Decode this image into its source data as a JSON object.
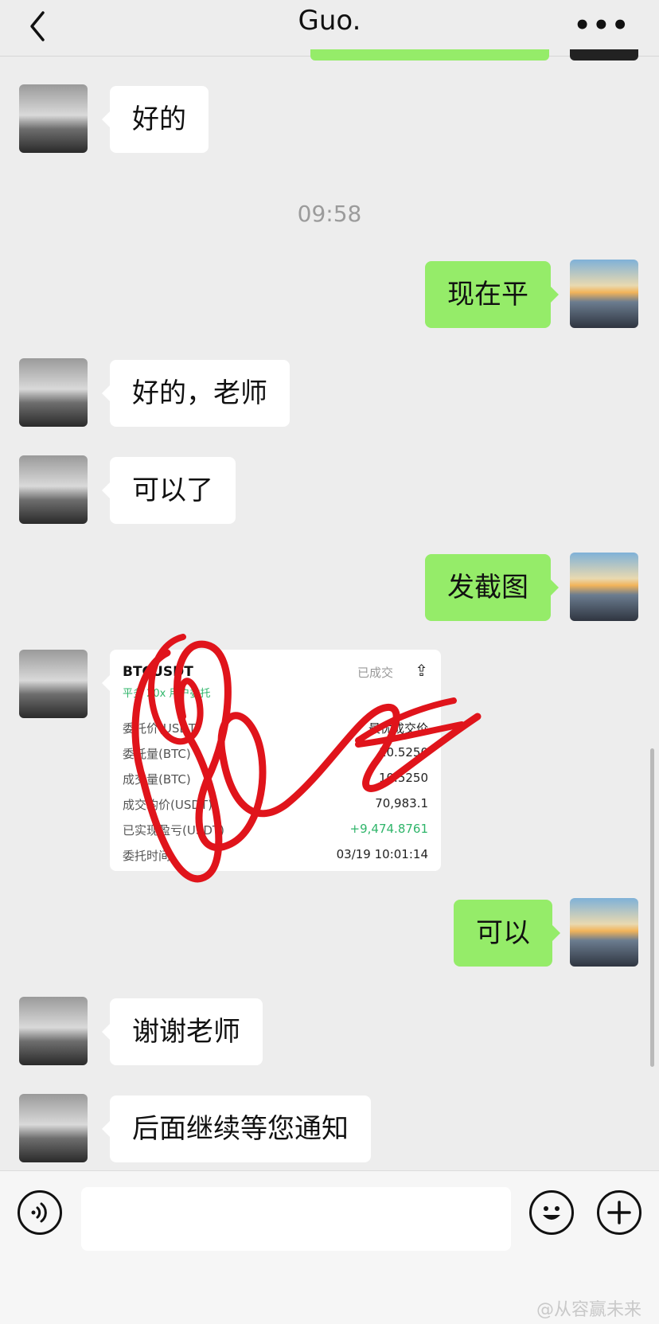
{
  "header": {
    "title": "Guo.",
    "more_label": "•••"
  },
  "timestamp": "09:58",
  "messages": [
    {
      "side": "left",
      "text": "好的"
    },
    {
      "side": "right",
      "text": "现在平"
    },
    {
      "side": "left",
      "text": "好的，老师"
    },
    {
      "side": "left",
      "text": "可以了"
    },
    {
      "side": "right",
      "text": "发截图"
    },
    {
      "side": "right",
      "text": "可以"
    },
    {
      "side": "left",
      "text": "谢谢老师"
    },
    {
      "side": "left",
      "text": "后面继续等您通知"
    }
  ],
  "trade_card": {
    "pair": "BTCUSDT",
    "sub": "平多 20x 用户委托",
    "status": "已成交",
    "rows": [
      {
        "label": "委托价(USDT)",
        "value": "最优成交价"
      },
      {
        "label": "委托量(BTC)",
        "value": "10.5250"
      },
      {
        "label": "成交量(BTC)",
        "value": "10.5250"
      },
      {
        "label": "成交均价(USDT)",
        "value": "70,983.1"
      },
      {
        "label": "已实现盈亏(USDT)",
        "value": "+9,474.8761"
      },
      {
        "label": "委托时间",
        "value": "03/19 10:01:14"
      }
    ]
  },
  "watermark": "@从容赢未来",
  "colors": {
    "sent_bubble": "#95ec69",
    "received_bubble": "#ffffff",
    "background": "#ededed",
    "gain": "#2fb56a",
    "scribble": "#e0141b"
  }
}
